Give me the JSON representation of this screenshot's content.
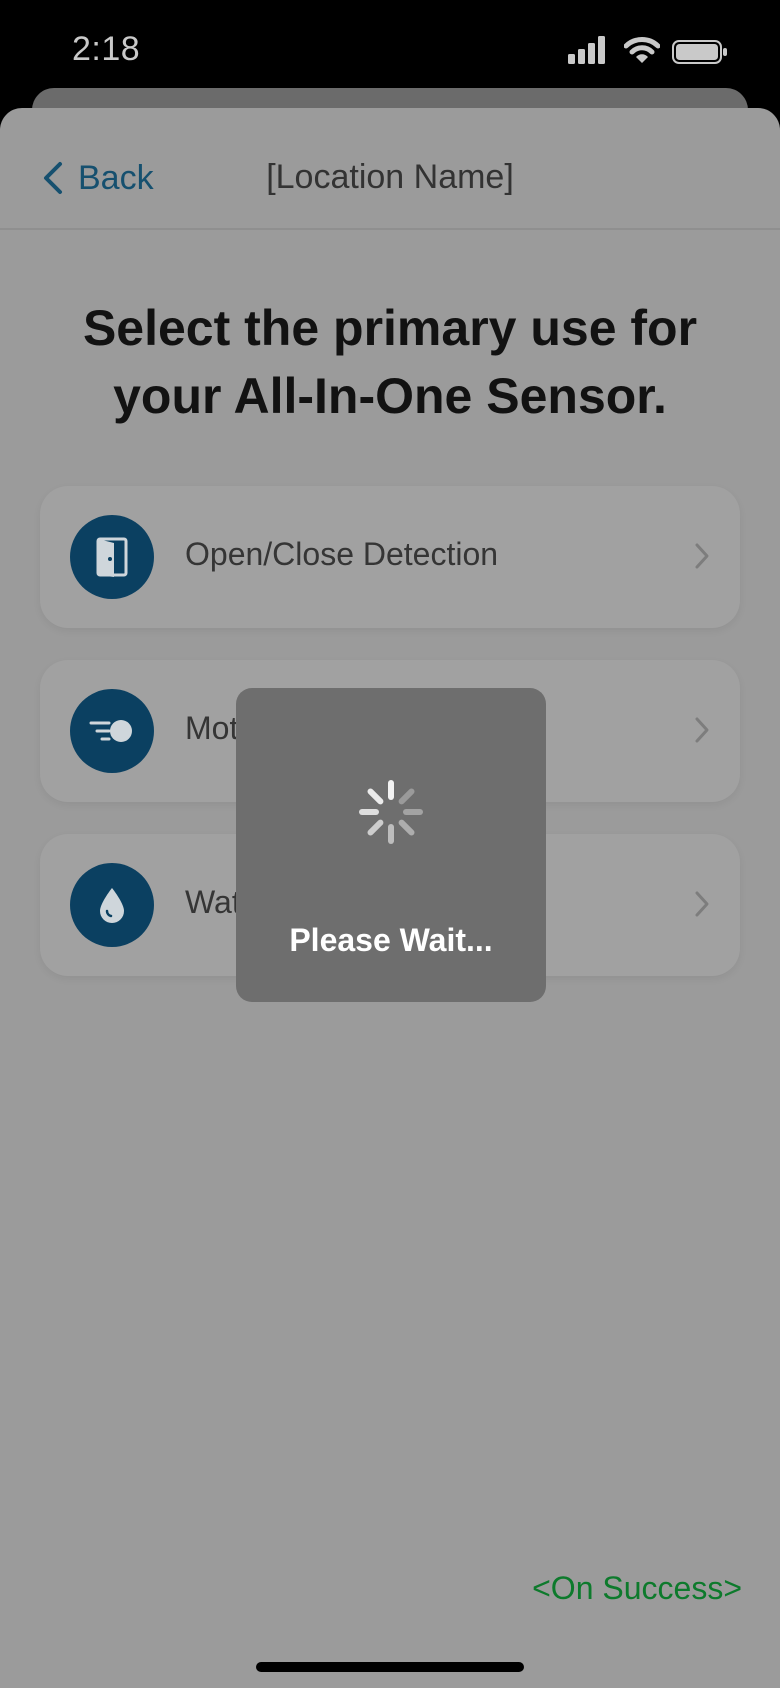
{
  "status_bar": {
    "time": "2:18"
  },
  "nav": {
    "back_label": "Back",
    "title": "[Location Name]"
  },
  "page": {
    "title": "Select the primary use for your All-In-One Sensor."
  },
  "options": [
    {
      "label": "Open/Close Detection",
      "icon": "door-icon"
    },
    {
      "label": "Motion Detection",
      "icon": "motion-icon"
    },
    {
      "label": "Water Leak Detection",
      "icon": "water-drop-icon"
    }
  ],
  "loading": {
    "message": "Please Wait..."
  },
  "annotation": {
    "success_label": "<On Success>"
  },
  "colors": {
    "accent": "#0b4061",
    "link": "#16506f",
    "success": "#0d7a2c"
  }
}
